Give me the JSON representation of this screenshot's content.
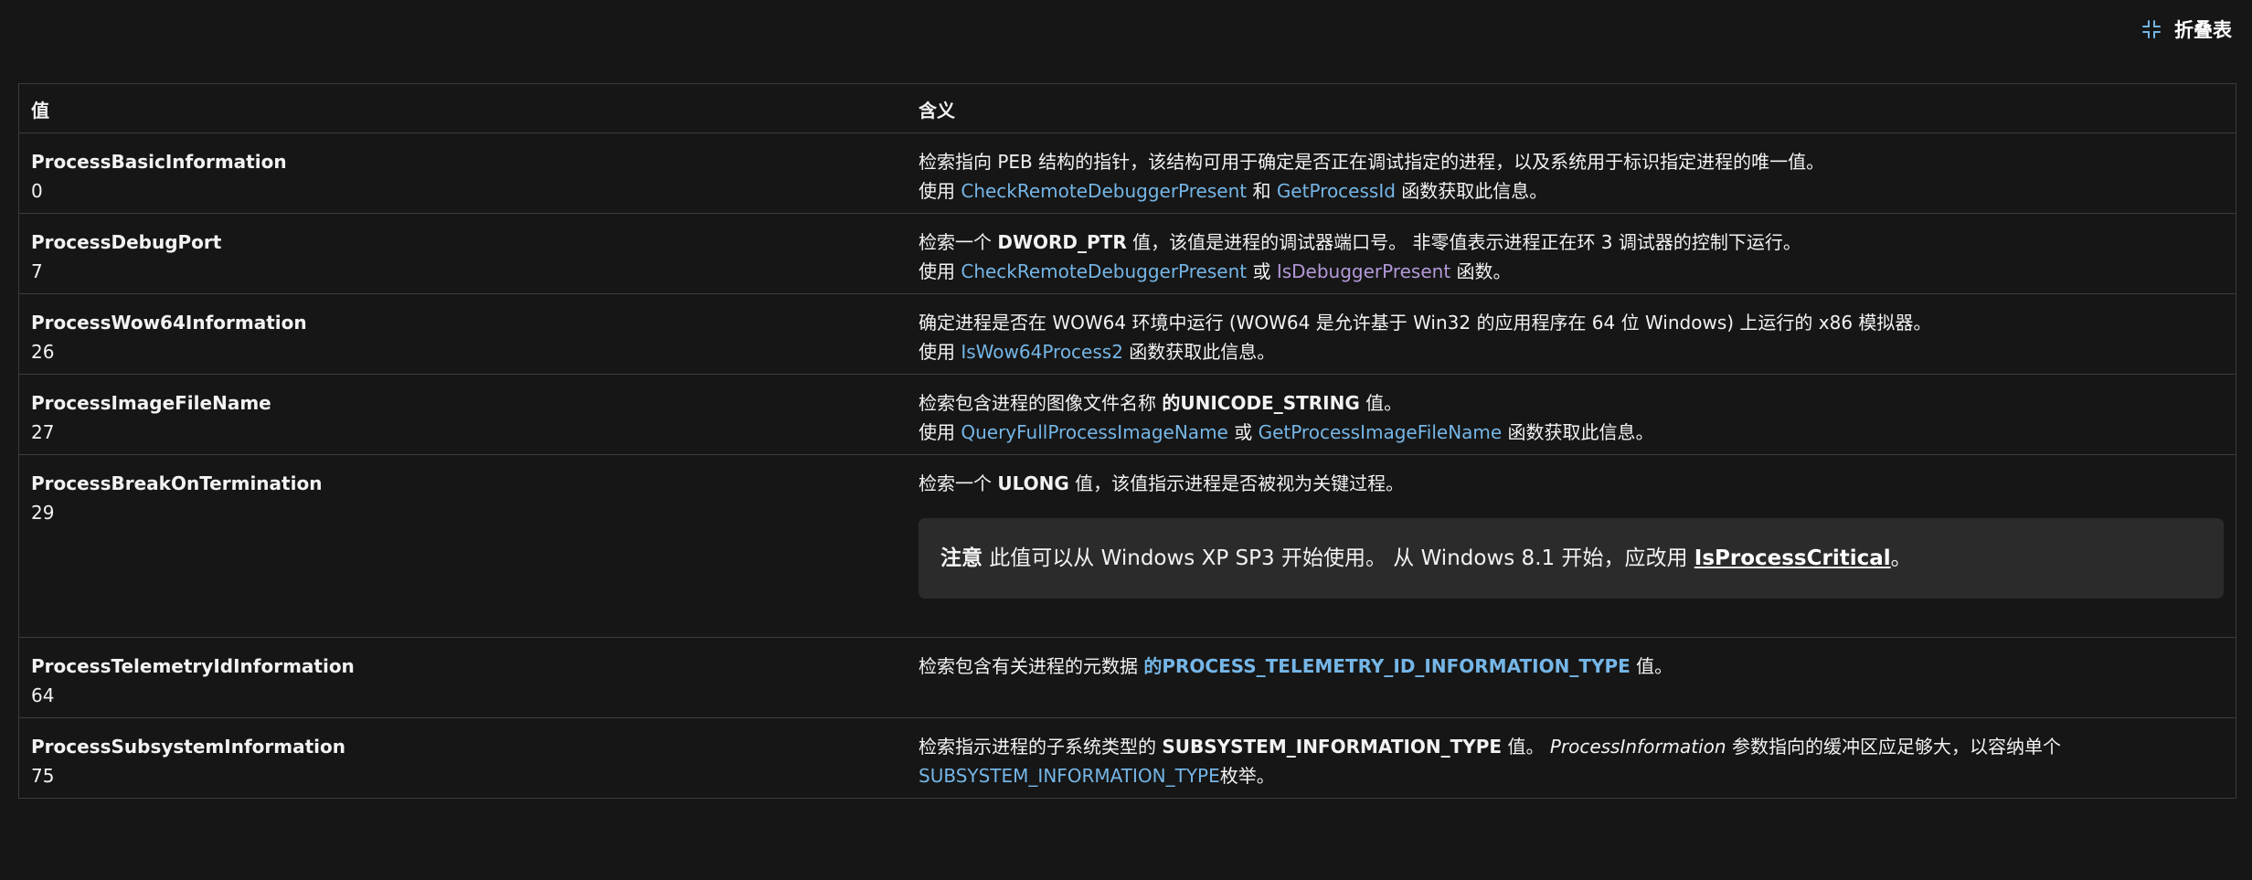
{
  "toolbar": {
    "collapse_label": "折叠表",
    "collapse_icon": "collapse-icon"
  },
  "table": {
    "headers": [
      "值",
      "含义"
    ],
    "rows": [
      {
        "name": "ProcessBasicInformation",
        "value": "0",
        "line1": "检索指向 PEB 结构的指针，该结构可用于确定是否正在调试指定的进程，以及系统用于标识指定进程的唯一值。",
        "line2_pre": "使用 ",
        "link1": "CheckRemoteDebuggerPresent",
        "mid": " 和 ",
        "link2": "GetProcessId",
        "post": " 函数获取此信息。"
      },
      {
        "name": "ProcessDebugPort",
        "value": "7",
        "line1_pre": "检索一个 ",
        "line1_bold": "DWORD_PTR",
        "line1_post": " 值，该值是进程的调试器端口号。 非零值表示进程正在环 3 调试器的控制下运行。",
        "line2_pre": "使用 ",
        "link1": "CheckRemoteDebuggerPresent",
        "mid": " 或 ",
        "link2": "IsDebuggerPresent",
        "post": " 函数。"
      },
      {
        "name": "ProcessWow64Information",
        "value": "26",
        "line1": "确定进程是否在 WOW64 环境中运行 (WOW64 是允许基于 Win32 的应用程序在 64 位 Windows) 上运行的 x86 模拟器。",
        "line2_pre": "使用 ",
        "link1": "IsWow64Process2",
        "post": " 函数获取此信息。"
      },
      {
        "name": "ProcessImageFileName",
        "value": "27",
        "line1_pre": "检索包含进程的图像文件名称 ",
        "line1_bold": "的UNICODE_STRING",
        "line1_post": " 值。",
        "line2_pre": "使用 ",
        "link1": "QueryFullProcessImageName",
        "mid": " 或 ",
        "link2": "GetProcessImageFileName",
        "post": " 函数获取此信息。"
      },
      {
        "name": "ProcessBreakOnTermination",
        "value": "29",
        "line1_pre": "检索一个 ",
        "line1_bold": "ULONG",
        "line1_post": " 值，该值指示进程是否被视为关键过程。",
        "note_title": "注意",
        "note_text": " 此值可以从 Windows XP SP3 开始使用。 从 Windows 8.1 开始，应改用 ",
        "note_link": "IsProcessCritical",
        "note_post": "。"
      },
      {
        "name": "ProcessTelemetryIdInformation",
        "value": "64",
        "line1_pre": "检索包含有关进程的元数据 ",
        "line1_link": "的PROCESS_TELEMETRY_ID_INFORMATION_TYPE",
        "line1_post": " 值。"
      },
      {
        "name": "ProcessSubsystemInformation",
        "value": "75",
        "line1_pre": "检索指示进程的子系统类型的 ",
        "line1_bold": "SUBSYSTEM_INFORMATION_TYPE",
        "line1_mid": " 值。 ",
        "line1_italic": "ProcessInformation",
        "line1_post": " 参数指向的缓冲区应足够大，以容纳单个",
        "line2_link": "SUBSYSTEM_INFORMATION_TYPE",
        "line2_post": "枚举。"
      }
    ]
  }
}
